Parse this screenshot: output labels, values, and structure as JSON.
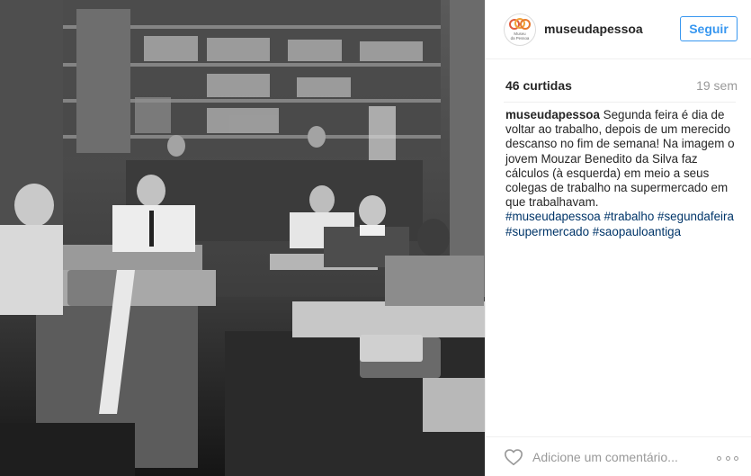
{
  "post": {
    "username": "museudapessoa",
    "follow_label": "Seguir",
    "likes": "46 curtidas",
    "age": "19 sem",
    "caption_text": "Segunda feira é dia de voltar ao trabalho, depois de um merecido descanso no fim de semana! Na imagem o jovem Mouzar Benedito da Silva faz cálculos (à esquerda) em meio a seus colegas de trabalho na supermercado em que trabalhavam.",
    "hashtags": [
      "#museudapessoa",
      "#trabalho",
      "#segundafeira",
      "#supermercado",
      "#saopauloantiga"
    ],
    "avatar_text": [
      "Museu",
      "da Pessoa"
    ],
    "comment_placeholder": "Adicione um comentário..."
  },
  "colors": {
    "accent": "#3897f0",
    "hashtag": "#003569",
    "muted": "#999999",
    "border": "#efefef"
  },
  "icons": {
    "like": "heart-icon",
    "options": "more-icon"
  }
}
